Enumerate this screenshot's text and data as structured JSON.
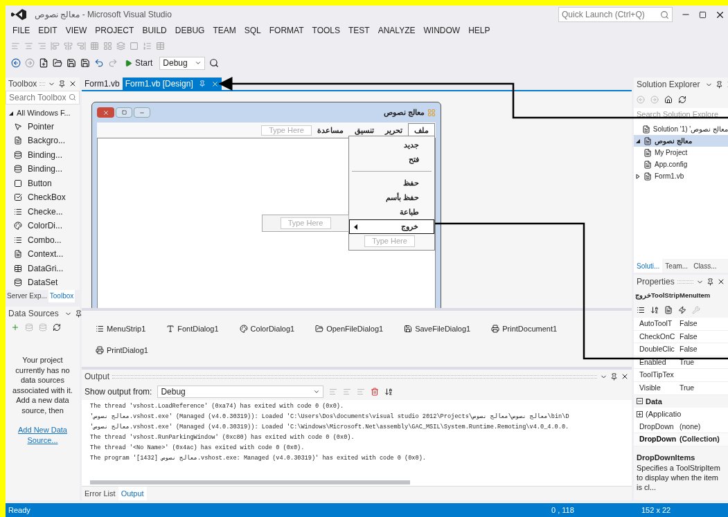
{
  "window": {
    "title": "معالج نصوص - Microsoft Visual Studio",
    "quick_launch": {
      "placeholder": "Quick Launch (Ctrl+Q)"
    }
  },
  "menu": [
    "FILE",
    "EDIT",
    "VIEW",
    "PROJECT",
    "BUILD",
    "DEBUG",
    "TEAM",
    "SQL",
    "FORMAT",
    "TOOLS",
    "TEST",
    "ANALYZE",
    "WINDOW",
    "HELP"
  ],
  "toolbar": {
    "start": "Start",
    "configuration": "Debug"
  },
  "toolbox": {
    "title": "Toolbox",
    "search": {
      "placeholder": "Search Toolbox"
    },
    "group": {
      "label": "All Windows F...",
      "expanded": true
    },
    "items": [
      {
        "label": "Pointer"
      },
      {
        "label": "Backgro..."
      },
      {
        "label": "Binding..."
      },
      {
        "label": "Binding..."
      },
      {
        "label": "Button"
      },
      {
        "label": "CheckBox"
      },
      {
        "label": "Checke..."
      },
      {
        "label": "ColorDi..."
      },
      {
        "label": "Combo..."
      },
      {
        "label": "Context..."
      },
      {
        "label": "DataGri..."
      },
      {
        "label": "DataSet"
      }
    ],
    "tabs": [
      {
        "label": "Server Exp...",
        "selected": false
      },
      {
        "label": "Toolbox",
        "selected": true
      }
    ]
  },
  "data_sources": {
    "title": "Data Sources",
    "message": "Your project currently has no data sources associated with it. Add a new data source, then",
    "link": "Add New Data Source..."
  },
  "doc_tabs": [
    {
      "label": "Form1.vb",
      "selected": false
    },
    {
      "label": "Form1.vb [Design]",
      "selected": true
    }
  ],
  "form": {
    "title": "معالج نصوص",
    "menu": [
      {
        "label": "ملف",
        "selected": true
      },
      {
        "label": "تحرير",
        "selected": false
      },
      {
        "label": "تنسيق",
        "selected": false
      },
      {
        "label": "مساعدة",
        "selected": false
      }
    ],
    "menu_placeholder": "Type Here",
    "dropdown": [
      {
        "kind": "item",
        "label": "جديد",
        "selected": false
      },
      {
        "kind": "item",
        "label": "فتح",
        "selected": false
      },
      {
        "kind": "separator"
      },
      {
        "kind": "item",
        "label": "حفظ",
        "selected": false
      },
      {
        "kind": "item",
        "label": "حفظ بأسم",
        "selected": false
      },
      {
        "kind": "item",
        "label": "طباعة",
        "selected": false
      },
      {
        "kind": "item",
        "label": "خروج",
        "selected": true
      }
    ],
    "dropdown_placeholder": "Type Here",
    "submenu_placeholder": "Type Here"
  },
  "components": [
    "MenuStrip1",
    "FontDialog1",
    "ColorDialog1",
    "OpenFileDialog1",
    "SaveFileDialog1",
    "PrintDocument1",
    "PrintDialog1"
  ],
  "output": {
    "title": "Output",
    "source_label": "Show output from:",
    "source": "Debug",
    "lines": [
      "The thread 'vshost.LoadReference' (0xa74) has exited with code 0 (0x0).",
      "'معالج نصوص.vshost.exe' (Managed (v4.0.30319)): Loaded 'C:\\Users\\Dos\\documents\\visual studio 2012\\Projects\\معالج نصوص\\معالج نصوص\\bin\\D",
      "'معالج نصوص.vshost.exe' (Managed (v4.0.30319)): Loaded 'C:\\Windows\\Microsoft.Net\\assembly\\GAC_MSIL\\System.Runtime.Remoting\\v4.0_4.0.0.",
      "The thread 'vshost.RunParkingWindow' (0xc80) has exited with code 0 (0x0).",
      "The thread '<No Name>' (0x4ac) has exited with code 0 (0x0).",
      "The program '[1432] معالج نصوص.vshost.exe: Managed (v4.0.30319)' has exited with code 0 (0x0)."
    ],
    "tabs": [
      {
        "label": "Error List",
        "selected": false
      },
      {
        "label": "Output",
        "selected": true
      }
    ]
  },
  "solution_explorer": {
    "title": "Solution Explorer",
    "search": {
      "placeholder": "Search Solution Explore"
    },
    "tree": [
      {
        "label": "Solution 'معالج نصوص' (1",
        "selected": false,
        "children": [
          {
            "label": "معالج نصوص",
            "selected": true,
            "expanded": true,
            "children": [
              {
                "label": "My Project",
                "selected": false
              },
              {
                "label": "App.config",
                "selected": false
              },
              {
                "label": "Form1.vb",
                "selected": false,
                "expanded": false
              }
            ]
          }
        ]
      }
    ],
    "tabs": [
      {
        "label": "Soluti...",
        "selected": true
      },
      {
        "label": "Team...",
        "selected": false
      },
      {
        "label": "Class...",
        "selected": false
      }
    ]
  },
  "properties": {
    "title": "Properties",
    "object": "خروجToolStripMenuItem",
    "rows": [
      {
        "kind": "property",
        "name": "AutoToolT",
        "value": "False",
        "changed": false
      },
      {
        "kind": "property",
        "name": "CheckOnC",
        "value": "False",
        "changed": false
      },
      {
        "kind": "property",
        "name": "DoubleClic",
        "value": "False",
        "changed": false
      },
      {
        "kind": "property",
        "name": "Enabled",
        "value": "True",
        "changed": false
      },
      {
        "kind": "property",
        "name": "ToolTipTex",
        "changed": false
      },
      {
        "kind": "property",
        "name": "Visible",
        "value": "True",
        "changed": false
      },
      {
        "kind": "category",
        "name": "Data",
        "expanded": true
      },
      {
        "kind": "group",
        "name": "(Applicatio",
        "expanded": false
      },
      {
        "kind": "property",
        "name": "DropDown",
        "value": "(none)",
        "changed": false
      },
      {
        "kind": "property",
        "name": "DropDown",
        "value": "(Collection)",
        "changed": true
      }
    ],
    "description": {
      "title": "DropDownItems",
      "text": "Specifies a ToolStripItem to display when the item is cl..."
    }
  },
  "status_bar": {
    "text": "Ready",
    "position": "0 , 118",
    "size": "152 x 22"
  }
}
